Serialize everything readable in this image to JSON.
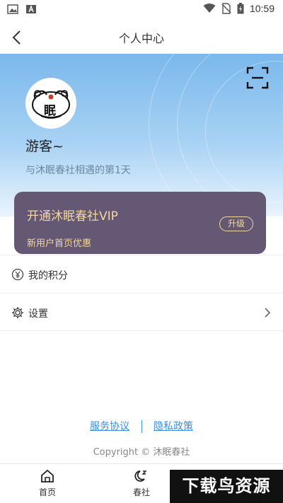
{
  "status_bar": {
    "time": "10:59",
    "icons": [
      "image-icon",
      "font-icon",
      "wifi-icon",
      "no-sim-icon",
      "battery-icon"
    ]
  },
  "nav": {
    "title": "个人中心",
    "back_icon": "back-arrow-icon"
  },
  "profile": {
    "username": "游客~",
    "days_text": "与沐眠春社相遇的第1天",
    "avatar_char": "眠",
    "scan_icon": "scan-icon"
  },
  "vip": {
    "title": "开通沐眠春社VIP",
    "subtitle": "新用户首页优惠",
    "button": "升级"
  },
  "menu": [
    {
      "label": "我的积分",
      "icon": "yen-icon"
    },
    {
      "label": "设置",
      "icon": "gear-icon"
    }
  ],
  "footer": {
    "service_link": "服务协议",
    "privacy_link": "隐私政策",
    "copyright": "Copyright © 沐眠春社"
  },
  "tabs": [
    {
      "label": "首页",
      "icon": "home-icon"
    },
    {
      "label": "春社",
      "icon": "moon-icon"
    }
  ],
  "watermark": "下载鸟资源",
  "colors": {
    "hero_top": "#7ab8ec",
    "vip_bg": "#655874",
    "vip_gold": "#f3d79f",
    "link": "#3a8ee6"
  }
}
